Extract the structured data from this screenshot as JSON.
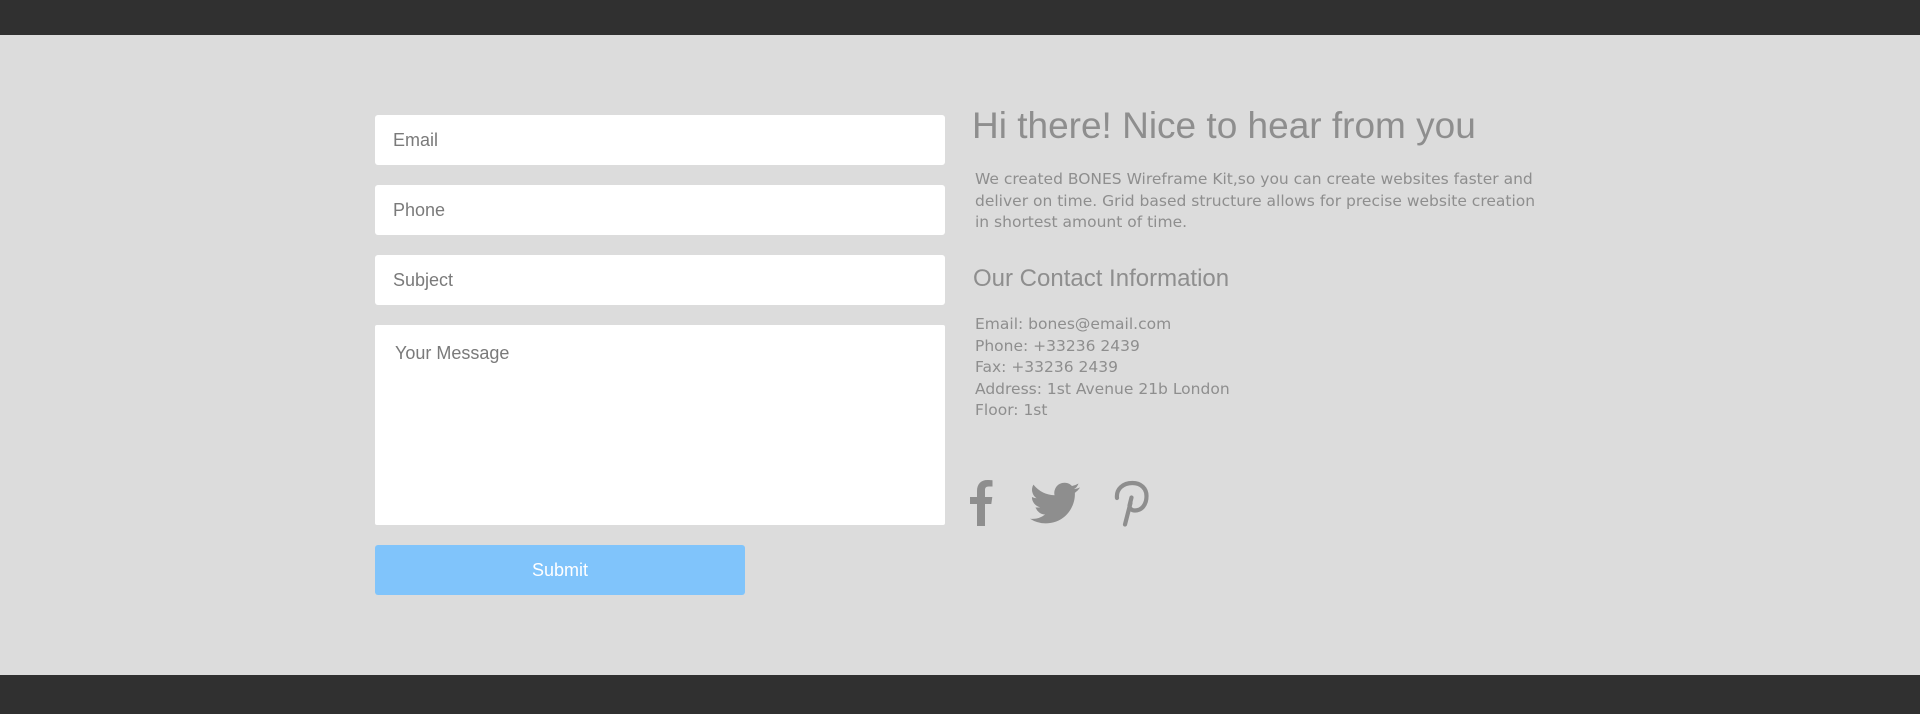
{
  "form": {
    "email_placeholder": "Email",
    "phone_placeholder": "Phone",
    "subject_placeholder": "Subject",
    "message_placeholder": "Your Message",
    "submit_label": "Submit"
  },
  "info": {
    "headline": "Hi there! Nice to hear from you",
    "intro": "We created BONES Wireframe Kit,so you can create websites faster and deliver on time. Grid based structure allows for precise website creation in shortest amount of time.",
    "contact_heading": "Our Contact Information",
    "contact_lines": [
      "Email: bones@email.com",
      "Phone: +33236 2439",
      "Fax: +33236 2439",
      "Address: 1st Avenue 21b London",
      "Floor: 1st"
    ]
  },
  "social": {
    "icons": [
      "facebook-icon",
      "twitter-icon",
      "pinterest-icon"
    ]
  },
  "colors": {
    "page_background": "#dcdcdc",
    "bars": "#303030",
    "text": "#8e8e8e",
    "submit_button": "#80c4fb"
  }
}
